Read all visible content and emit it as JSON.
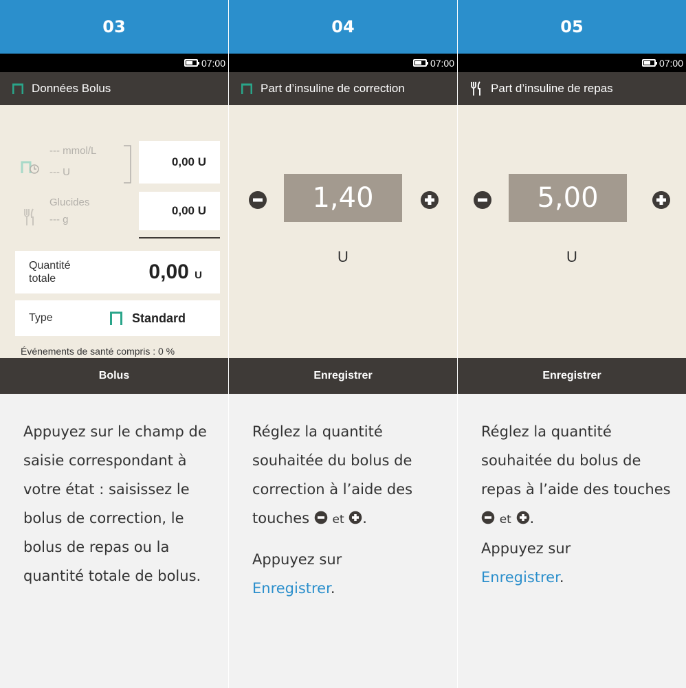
{
  "columns": [
    {
      "step": "03",
      "status_time": "07:00",
      "title": "Données Bolus",
      "correction": {
        "bg": "--- mmol/L",
        "units": "--- U",
        "value": "0,00 U"
      },
      "carbs": {
        "label": "Glucides",
        "grams": "--- g",
        "value": "0,00 U"
      },
      "total": {
        "label_line1": "Quantité",
        "label_line2": "totale",
        "value": "0,00",
        "unit": "U"
      },
      "type": {
        "label": "Type",
        "value": "Standard"
      },
      "health": "Événements de santé compris : 0 %",
      "button": "Bolus",
      "description": {
        "text": "Appuyez sur le champ de saisie correspondant à votre état : saisissez le bolus de correction, le bolus de repas ou la quantité totale de bolus."
      }
    },
    {
      "step": "04",
      "status_time": "07:00",
      "title": "Part d’insuline de correction",
      "value": "1,40",
      "unit": "U",
      "button": "Enregistrer",
      "description": {
        "p1_a": "Réglez la quantité souhaitée du bolus de correction à l’aide des touches",
        "p1_b": "et",
        "p1_c": ".",
        "p2_a": "Appuyez sur",
        "p2_link": "Enregistrer",
        "p2_c": "."
      }
    },
    {
      "step": "05",
      "status_time": "07:00",
      "title": "Part d’insuline de repas",
      "value": "5,00",
      "unit": "U",
      "button": "Enregistrer",
      "description": {
        "p1_a": "Réglez la quantité souhaitée du bolus de repas à l’aide des touches",
        "p1_b": "et",
        "p1_c": ".",
        "p2_a": "Appuyez sur",
        "p2_link": "Enregistrer",
        "p2_c": "."
      }
    }
  ],
  "colors": {
    "header_blue": "#2b8fcc",
    "dark_bar": "#3e3a37",
    "screen_bg": "#f0ebe0",
    "bolus_green": "#2aa58a",
    "value_box": "#a39a8f",
    "description_bg": "#f2f2f2"
  },
  "icons": [
    "bolus-standard-icon",
    "fork-knife-icon",
    "bolus-clock-icon",
    "minus-icon",
    "plus-icon",
    "battery-icon"
  ]
}
